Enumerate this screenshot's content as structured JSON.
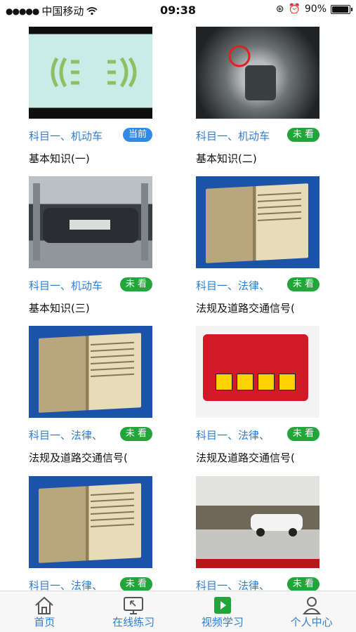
{
  "status_bar": {
    "carrier": "中国移动",
    "time": "09:38",
    "battery": "90%",
    "battery_level": 0.9
  },
  "videos": [
    {
      "subject": "科目一、机动车",
      "badge": "当前",
      "title": "基本知识(一)",
      "badge_type": "current"
    },
    {
      "subject": "科目一、机动车",
      "badge": "未 看",
      "title": "基本知识(二)",
      "badge_type": "unseen"
    },
    {
      "subject": "科目一、机动车",
      "badge": "未 看",
      "title": "基本知识(三)",
      "badge_type": "unseen"
    },
    {
      "subject": "科目一、法律、",
      "badge": "未 看",
      "title": "法规及道路交通信号(",
      "badge_type": "unseen"
    },
    {
      "subject": "科目一、法律、",
      "badge": "未 看",
      "title": "法规及道路交通信号(",
      "badge_type": "unseen"
    },
    {
      "subject": "科目一、法律、",
      "badge": "未 看",
      "title": "法规及道路交通信号(",
      "badge_type": "unseen"
    },
    {
      "subject": "科目一、法律、",
      "badge": "未 看",
      "title": "",
      "badge_type": "unseen"
    },
    {
      "subject": "科目一、法律、",
      "badge": "未 看",
      "title": "",
      "badge_type": "unseen"
    }
  ],
  "tabs": [
    {
      "label": "首页",
      "icon": "home-icon"
    },
    {
      "label": "在线练习",
      "icon": "monitor-icon"
    },
    {
      "label": "视频学习",
      "icon": "play-icon"
    },
    {
      "label": "个人中心",
      "icon": "person-icon"
    }
  ],
  "colors": {
    "accent": "#2f7fd0",
    "badge_green": "#22a63a",
    "badge_blue": "#2f8ae6"
  }
}
